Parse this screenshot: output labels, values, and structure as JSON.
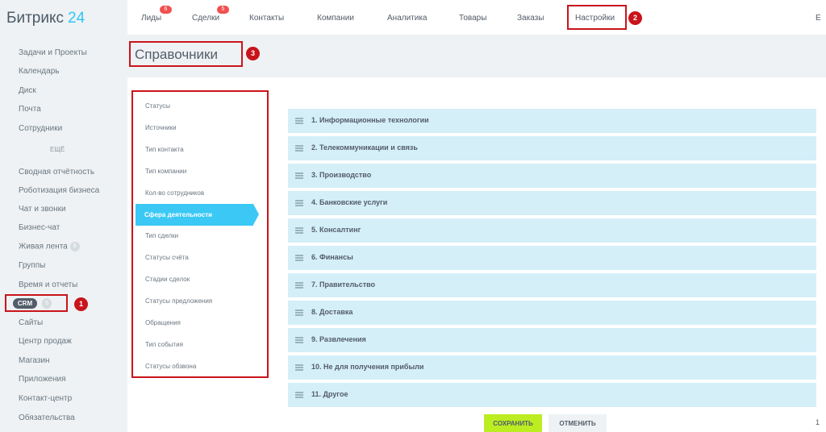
{
  "app": {
    "logo_text": "Битрикс",
    "logo_num": "24"
  },
  "sidebar": {
    "items": [
      {
        "label": "Задачи и Проекты"
      },
      {
        "label": "Календарь"
      },
      {
        "label": "Диск"
      },
      {
        "label": "Почта"
      },
      {
        "label": "Сотрудники"
      },
      {
        "label": "ЕЩЁ"
      },
      {
        "label": "Сводная отчётность"
      },
      {
        "label": "Роботизация бизнеса"
      },
      {
        "label": "Чат и звонки"
      },
      {
        "label": "Бизнес-чат"
      },
      {
        "label": "Живая лента",
        "count": "6"
      },
      {
        "label": "Группы"
      },
      {
        "label": "Время и отчеты"
      },
      {
        "label": "Сайты"
      },
      {
        "label": "Центр продаж"
      },
      {
        "label": "Магазин"
      },
      {
        "label": "Приложения"
      },
      {
        "label": "Контакт-центр"
      },
      {
        "label": "Обязательства"
      }
    ],
    "crm": {
      "label": "CRM",
      "count": "5"
    }
  },
  "nav": {
    "items": [
      {
        "label": "Лиды",
        "badge": "6"
      },
      {
        "label": "Сделки",
        "badge": "5"
      },
      {
        "label": "Контакты"
      },
      {
        "label": "Компании"
      },
      {
        "label": "Аналитика"
      },
      {
        "label": "Товары"
      },
      {
        "label": "Заказы"
      },
      {
        "label": "Настройки"
      }
    ],
    "edge": "Е"
  },
  "page": {
    "title": "Справочники"
  },
  "markers": {
    "m1": "1",
    "m2": "2",
    "m3": "3"
  },
  "references": {
    "items": [
      {
        "label": "Статусы"
      },
      {
        "label": "Источники"
      },
      {
        "label": "Тип контакта"
      },
      {
        "label": "Тип компании"
      },
      {
        "label": "Кол-во сотрудников"
      },
      {
        "label": "Сфера деятельности"
      },
      {
        "label": "Тип сделки"
      },
      {
        "label": "Статусы счёта"
      },
      {
        "label": "Стадии сделок"
      },
      {
        "label": "Статусы предложения"
      },
      {
        "label": "Обращения"
      },
      {
        "label": "Тип события"
      },
      {
        "label": "Статусы обзвона"
      }
    ]
  },
  "values": {
    "items": [
      {
        "label": "1. Информационные технологии"
      },
      {
        "label": "2. Телекоммуникации и связь"
      },
      {
        "label": "3. Производство"
      },
      {
        "label": "4. Банковские услуги"
      },
      {
        "label": "5. Консалтинг"
      },
      {
        "label": "6. Финансы"
      },
      {
        "label": "7. Правительство"
      },
      {
        "label": "8. Доставка"
      },
      {
        "label": "9. Развлечения"
      },
      {
        "label": "10. Не для получения прибыли"
      },
      {
        "label": "11. Другое"
      }
    ]
  },
  "buttons": {
    "save": "Сохранить",
    "cancel": "Отменить"
  },
  "footer": {
    "edge": "1"
  }
}
